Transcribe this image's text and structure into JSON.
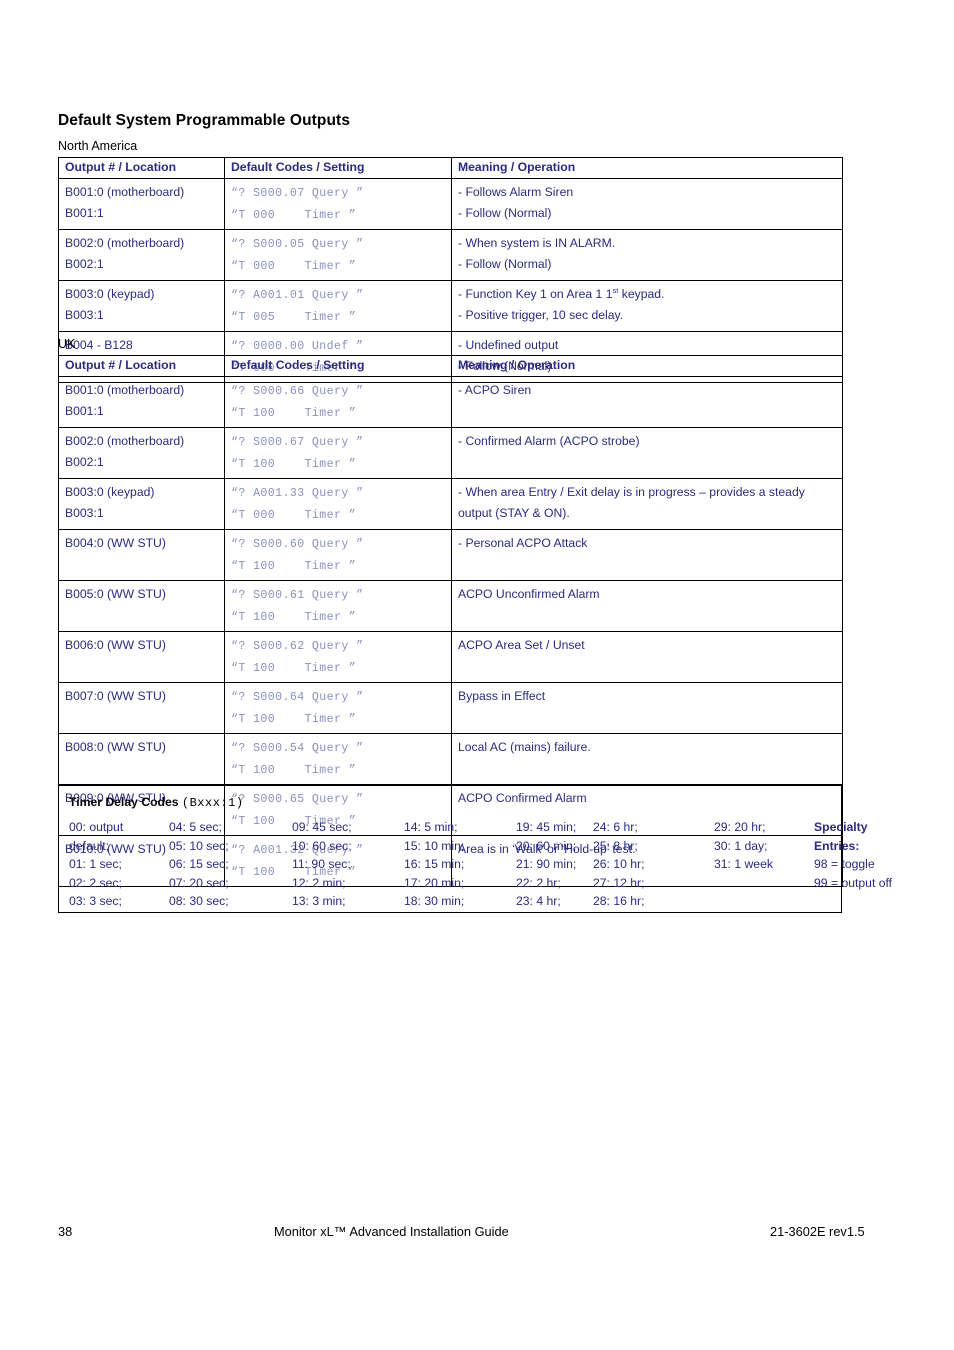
{
  "document": {
    "title": "Default System Programmable Outputs"
  },
  "sections": [
    {
      "label": "North America",
      "headers": [
        "Output # / Location",
        "Default Codes / Setting",
        "Meaning / Operation"
      ],
      "rows": [
        {
          "output_lines": [
            "B001:0 (motherboard)",
            "B001:1"
          ],
          "code_lines": [
            "“? S000.07 Query ”",
            "“T 000    Timer ”"
          ],
          "meaning_lines": [
            "- Follows Alarm Siren",
            "- Follow (Normal)"
          ]
        },
        {
          "output_lines": [
            "B002:0 (motherboard)",
            "B002:1"
          ],
          "code_lines": [
            "“? S000.05 Query ”",
            "“T 000    Timer ”"
          ],
          "meaning_lines": [
            "- When system is IN ALARM.",
            "- Follow (Normal)"
          ]
        },
        {
          "output_lines": [
            "B003:0 (keypad)",
            "B003:1"
          ],
          "code_lines": [
            "“? A001.01 Query ”",
            "“T 005    Timer ”"
          ],
          "meaning_lines": [
            "- Function Key 1 on Area 1 1st keypad.",
            "- Positive trigger, 10 sec delay."
          ],
          "meaning_superscript": [
            {
              "line": 0,
              "text": "- Function Key 1 on Area 1 1",
              "sup": "st",
              "after": " keypad."
            }
          ]
        },
        {
          "output_lines": [
            "B004 - B128",
            ""
          ],
          "code_lines": [
            "“? 0000.00 Undef ”",
            "“T 000    Timer ”"
          ],
          "meaning_lines": [
            "- Undefined output",
            "- Follow (Normal)"
          ]
        }
      ]
    },
    {
      "label": "UK",
      "headers": [
        "Output # / Location",
        "Default Codes / Setting",
        "Meaning / Operation"
      ],
      "rows": [
        {
          "output_lines": [
            "B001:0 (motherboard)",
            "B001:1"
          ],
          "code_lines": [
            "“? S000.66 Query ”",
            "“T 100    Timer ”"
          ],
          "meaning_lines": [
            "- ACPO Siren",
            ""
          ]
        },
        {
          "output_lines": [
            "B002:0 (motherboard)",
            "B002:1"
          ],
          "code_lines": [
            "“? S000.67 Query ”",
            "“T 100    Timer ”"
          ],
          "meaning_lines": [
            "- Confirmed Alarm (ACPO strobe)",
            ""
          ]
        },
        {
          "output_lines": [
            "B003:0 (keypad)",
            "B003:1"
          ],
          "code_lines": [
            "“? A001.33 Query ”",
            "“T 000    Timer ”"
          ],
          "meaning_wrapped": "- When area Entry / Exit delay is in progress – provides a steady output (STAY & ON)."
        },
        {
          "output_lines": [
            "B004:0 (WW STU)",
            ""
          ],
          "code_lines": [
            "“? S000.60 Query ”",
            "“T 100    Timer ”"
          ],
          "meaning_lines": [
            "- Personal ACPO Attack",
            ""
          ]
        },
        {
          "output_lines": [
            "B005:0 (WW STU)",
            ""
          ],
          "code_lines": [
            "“? S000.61 Query ”",
            "“T 100    Timer ”"
          ],
          "meaning_lines": [
            "ACPO Unconfirmed Alarm",
            ""
          ]
        },
        {
          "output_lines": [
            "B006:0 (WW STU)",
            ""
          ],
          "code_lines": [
            "“? S000.62 Query ”",
            "“T 100    Timer ”"
          ],
          "meaning_lines": [
            "ACPO Area Set / Unset",
            ""
          ]
        },
        {
          "output_lines": [
            "B007:0 (WW STU)",
            ""
          ],
          "code_lines": [
            "“? S000.64 Query ”",
            "“T 100    Timer ”"
          ],
          "meaning_lines": [
            "Bypass in Effect",
            ""
          ]
        },
        {
          "output_lines": [
            "B008:0 (WW STU)",
            ""
          ],
          "code_lines": [
            "“? S000.54 Query ”",
            "“T 100    Timer ”"
          ],
          "meaning_lines": [
            "Local AC (mains) failure.",
            ""
          ]
        },
        {
          "output_lines": [
            "B009:0 (WW STU)",
            ""
          ],
          "code_lines": [
            "“? S000.65 Query ”",
            "“T 100    Timer ”"
          ],
          "meaning_lines": [
            "ACPO Confirmed Alarm",
            ""
          ]
        },
        {
          "output_lines": [
            "B010:0 (WW STU)",
            ""
          ],
          "code_lines": [
            "“? A001.32 Query ”",
            "“T 100    Timer ”"
          ],
          "meaning_lines": [
            "Area is in ‘Walk’ or ‘Hold-up’ test.",
            ""
          ]
        }
      ]
    }
  ],
  "timer_box": {
    "title_bold": "Timer Delay Codes",
    "title_mono": "(Bxxx:1)",
    "columns": [
      [
        "00: output default;",
        "01: 1 sec;",
        "02: 2 sec;",
        "03: 3 sec;"
      ],
      [
        "04: 5 sec;",
        "05: 10 sec;",
        "06: 15 sec;",
        "07: 20 sec;",
        "08: 30 sec;"
      ],
      [
        "09: 45 sec;",
        "10: 60 sec;",
        "11: 90 sec;",
        "12: 2 min;",
        "13: 3 min;"
      ],
      [
        "14: 5 min;",
        "15: 10 min;",
        "16: 15 min;",
        "17: 20 min;",
        "18: 30 min;"
      ],
      [
        "19: 45 min;",
        "20: 60 min;",
        "21: 90 min;",
        "22: 2 hr;",
        "23: 4 hr;"
      ],
      [
        "24: 6 hr;",
        "25: 8 hr;",
        "26: 10 hr;",
        "27: 12 hr;",
        "28: 16 hr;"
      ],
      [
        "29: 20 hr;",
        "30: 1 day;",
        "31: 1 week"
      ],
      [
        "Specialty",
        "Entries:",
        "98 = toggle",
        "99 = output off"
      ]
    ],
    "specialty_heading_lines": 2
  },
  "footer": {
    "page_number": "38",
    "title": "Monitor xL™ Advanced Installation Guide",
    "doc_id": "21-3602E rev1.5"
  },
  "colors": {
    "text_blue": "#2b2b80",
    "code_blue": "#8a91bd",
    "black": "#000000"
  }
}
